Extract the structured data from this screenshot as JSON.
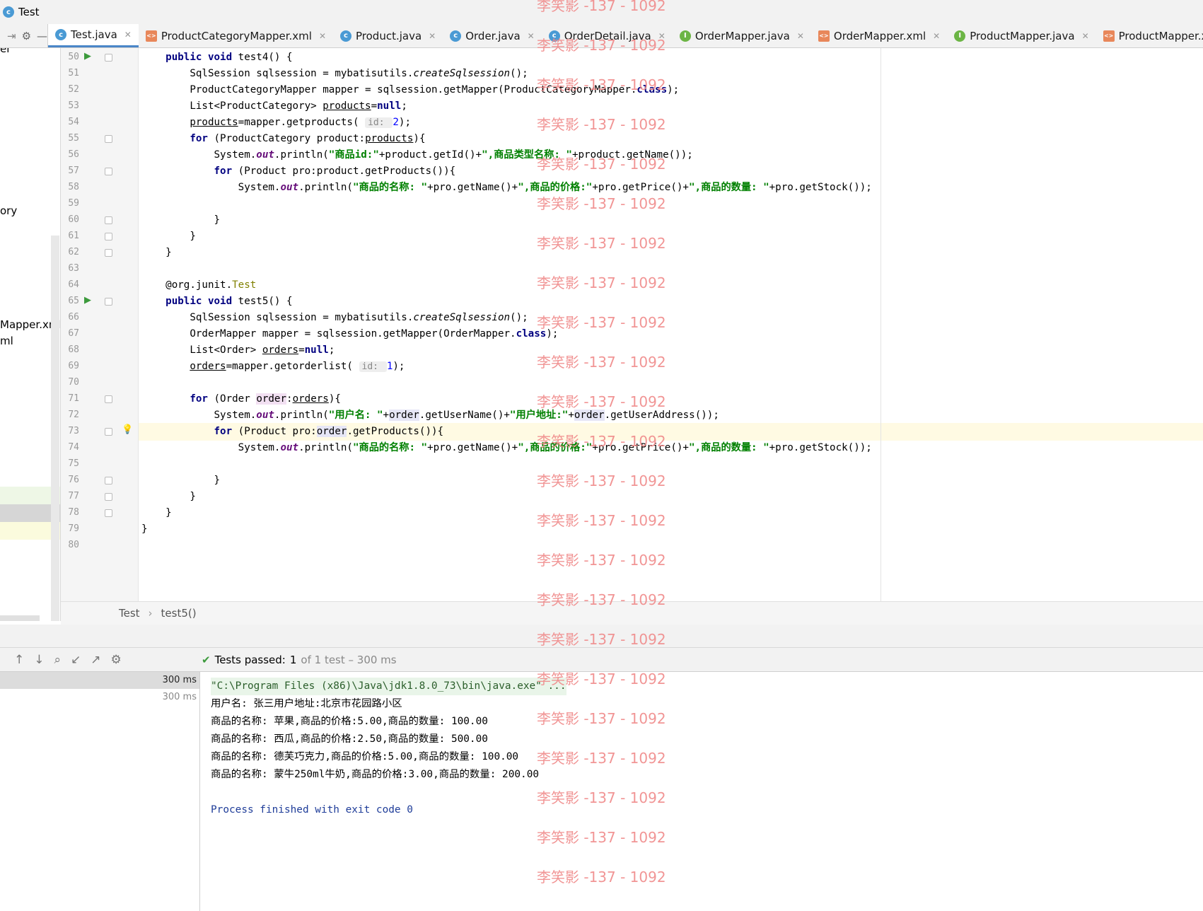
{
  "window": {
    "title": "Test"
  },
  "tabs": [
    {
      "label": "Test.java",
      "icon": "class-icon",
      "active": true
    },
    {
      "label": "ProductCategoryMapper.xml",
      "icon": "xml-icon"
    },
    {
      "label": "Product.java",
      "icon": "class-icon"
    },
    {
      "label": "Order.java",
      "icon": "class-icon"
    },
    {
      "label": "OrderDetail.java",
      "icon": "class-icon"
    },
    {
      "label": "OrderMapper.java",
      "icon": "interface-icon"
    },
    {
      "label": "OrderMapper.xml",
      "icon": "xml-icon"
    },
    {
      "label": "ProductMapper.java",
      "icon": "interface-icon"
    },
    {
      "label": "ProductMapper.xr",
      "icon": "xml-icon"
    }
  ],
  "project_panel": {
    "visible_fragments": [
      "er",
      "ory",
      "Mapper.xml",
      "ml"
    ]
  },
  "editor": {
    "line_numbers": [
      "50",
      "51",
      "52",
      "53",
      "54",
      "55",
      "56",
      "57",
      "58",
      "59",
      "60",
      "61",
      "62",
      "63",
      "64",
      "65",
      "66",
      "67",
      "68",
      "69",
      "70",
      "71",
      "72",
      "73",
      "74",
      "75",
      "76",
      "77",
      "78",
      "79",
      "80"
    ],
    "lines": [
      {
        "n": "50",
        "segs": [
          [
            "    ",
            ""
          ],
          [
            "public void ",
            "kw"
          ],
          [
            "test4() {",
            ""
          ]
        ]
      },
      {
        "n": "51",
        "segs": [
          [
            "        SqlSession sqlsession = mybatisutils.",
            ""
          ],
          [
            "createSqlsession",
            "it"
          ],
          [
            "();",
            ""
          ]
        ]
      },
      {
        "n": "52",
        "segs": [
          [
            "        ProductCategoryMapper mapper = sqlsession.getMapper(ProductCategoryMapper.",
            ""
          ],
          [
            "class",
            "kw"
          ],
          [
            ");",
            ""
          ]
        ]
      },
      {
        "n": "53",
        "segs": [
          [
            "        List<ProductCategory> ",
            ""
          ],
          [
            "products",
            "ul"
          ],
          [
            "=",
            ""
          ],
          [
            "null",
            "kw"
          ],
          [
            ";",
            ""
          ]
        ]
      },
      {
        "n": "54",
        "segs": [
          [
            "        ",
            ""
          ],
          [
            "products",
            "ul"
          ],
          [
            "=mapper.getproducts( ",
            ""
          ],
          [
            "id: ",
            "hint"
          ],
          [
            "2",
            "num"
          ],
          [
            ");",
            ""
          ]
        ]
      },
      {
        "n": "55",
        "segs": [
          [
            "        ",
            ""
          ],
          [
            "for ",
            "kw"
          ],
          [
            "(ProductCategory product:",
            ""
          ],
          [
            "products",
            "ul"
          ],
          [
            "){",
            ""
          ]
        ]
      },
      {
        "n": "56",
        "segs": [
          [
            "            System.",
            ""
          ],
          [
            "out",
            "fld"
          ],
          [
            ".println(",
            ""
          ],
          [
            "\"商品id:\"",
            "str"
          ],
          [
            "+product.getId()+",
            ""
          ],
          [
            "\",商品类型名称: \"",
            "str"
          ],
          [
            "+product.getName());",
            ""
          ]
        ]
      },
      {
        "n": "57",
        "segs": [
          [
            "            ",
            ""
          ],
          [
            "for ",
            "kw"
          ],
          [
            "(Product pro:product.getProducts()){",
            ""
          ]
        ]
      },
      {
        "n": "58",
        "segs": [
          [
            "                System.",
            ""
          ],
          [
            "out",
            "fld"
          ],
          [
            ".println(",
            ""
          ],
          [
            "\"商品的名称: \"",
            "str"
          ],
          [
            "+pro.getName()+",
            ""
          ],
          [
            "\",商品的价格:\"",
            "str"
          ],
          [
            "+pro.getPrice()+",
            ""
          ],
          [
            "\",商品的数量: \"",
            "str"
          ],
          [
            "+pro.getStock());",
            ""
          ]
        ]
      },
      {
        "n": "59",
        "segs": [
          [
            "",
            ""
          ]
        ]
      },
      {
        "n": "60",
        "segs": [
          [
            "            }",
            ""
          ]
        ]
      },
      {
        "n": "61",
        "segs": [
          [
            "        }",
            ""
          ]
        ]
      },
      {
        "n": "62",
        "segs": [
          [
            "    }",
            ""
          ]
        ]
      },
      {
        "n": "63",
        "segs": [
          [
            "",
            ""
          ]
        ]
      },
      {
        "n": "64",
        "segs": [
          [
            "    @org.junit.",
            ""
          ],
          [
            "Test",
            "ann"
          ]
        ]
      },
      {
        "n": "65",
        "segs": [
          [
            "    ",
            ""
          ],
          [
            "public void ",
            "kw"
          ],
          [
            "test5() {",
            ""
          ]
        ]
      },
      {
        "n": "66",
        "segs": [
          [
            "        SqlSession sqlsession = mybatisutils.",
            ""
          ],
          [
            "createSqlsession",
            "it"
          ],
          [
            "();",
            ""
          ]
        ]
      },
      {
        "n": "67",
        "segs": [
          [
            "        OrderMapper mapper = sqlsession.getMapper(OrderMapper.",
            ""
          ],
          [
            "class",
            "kw"
          ],
          [
            ");",
            ""
          ]
        ]
      },
      {
        "n": "68",
        "segs": [
          [
            "        List<Order> ",
            ""
          ],
          [
            "orders",
            "ul"
          ],
          [
            "=",
            ""
          ],
          [
            "null",
            "kw"
          ],
          [
            ";",
            ""
          ]
        ]
      },
      {
        "n": "69",
        "segs": [
          [
            "        ",
            ""
          ],
          [
            "orders",
            "ul"
          ],
          [
            "=mapper.getorderlist( ",
            ""
          ],
          [
            "id: ",
            "hint"
          ],
          [
            "1",
            "num"
          ],
          [
            ");",
            ""
          ]
        ]
      },
      {
        "n": "70",
        "segs": [
          [
            "",
            ""
          ]
        ]
      },
      {
        "n": "71",
        "segs": [
          [
            "        ",
            ""
          ],
          [
            "for ",
            "kw"
          ],
          [
            "(Order ",
            ""
          ],
          [
            "order",
            "hv"
          ],
          [
            ":",
            ""
          ],
          [
            "orders",
            "ul"
          ],
          [
            "){",
            ""
          ]
        ]
      },
      {
        "n": "72",
        "segs": [
          [
            "            System.",
            ""
          ],
          [
            "out",
            "fld"
          ],
          [
            ".println(",
            ""
          ],
          [
            "\"用户名: \"",
            "str"
          ],
          [
            "+",
            ""
          ],
          [
            "order",
            "hv2"
          ],
          [
            ".getUserName()+",
            ""
          ],
          [
            "\"用户地址:\"",
            "str"
          ],
          [
            "+",
            ""
          ],
          [
            "order",
            "hv2"
          ],
          [
            ".getUserAddress());",
            ""
          ]
        ]
      },
      {
        "n": "73",
        "segs": [
          [
            "            ",
            ""
          ],
          [
            "for ",
            "kw"
          ],
          [
            "(Product pro:",
            ""
          ],
          [
            "order",
            "hv2"
          ],
          [
            ".getProducts()){",
            ""
          ]
        ],
        "current": true
      },
      {
        "n": "74",
        "segs": [
          [
            "                System.",
            ""
          ],
          [
            "out",
            "fld"
          ],
          [
            ".println(",
            ""
          ],
          [
            "\"商品的名称: \"",
            "str"
          ],
          [
            "+pro.getName()+",
            ""
          ],
          [
            "\",商品的价格:\"",
            "str"
          ],
          [
            "+pro.getPrice()+",
            ""
          ],
          [
            "\",商品的数量: \"",
            "str"
          ],
          [
            "+pro.getStock());",
            ""
          ]
        ]
      },
      {
        "n": "75",
        "segs": [
          [
            "",
            ""
          ]
        ]
      },
      {
        "n": "76",
        "segs": [
          [
            "            }",
            ""
          ]
        ]
      },
      {
        "n": "77",
        "segs": [
          [
            "        }",
            ""
          ]
        ]
      },
      {
        "n": "78",
        "segs": [
          [
            "    }",
            ""
          ]
        ]
      },
      {
        "n": "79",
        "segs": [
          [
            "}",
            ""
          ]
        ]
      },
      {
        "n": "80",
        "segs": [
          [
            "",
            ""
          ]
        ]
      }
    ]
  },
  "breadcrumb": {
    "class": "Test",
    "method": "test5()"
  },
  "run": {
    "status_label": "Tests passed:",
    "passed_count": "1",
    "total_text": "of 1 test – 300 ms",
    "tree": [
      {
        "time": "300 ms",
        "selected": true
      },
      {
        "time": "300 ms",
        "selected": false
      }
    ],
    "console": [
      "\"C:\\Program Files (x86)\\Java\\jdk1.8.0_73\\bin\\java.exe\" ...",
      "用户名: 张三用户地址:北京市花园路小区",
      "商品的名称: 苹果,商品的价格:5.00,商品的数量: 100.00",
      "商品的名称: 西瓜,商品的价格:2.50,商品的数量: 500.00",
      "商品的名称: 德芙巧克力,商品的价格:5.00,商品的数量: 100.00",
      "商品的名称: 蒙牛250ml牛奶,商品的价格:3.00,商品的数量: 200.00",
      "",
      "Process finished with exit code 0"
    ]
  },
  "watermark": {
    "text": "李笑影 -137 - 1092",
    "color": "#f08a8a"
  }
}
